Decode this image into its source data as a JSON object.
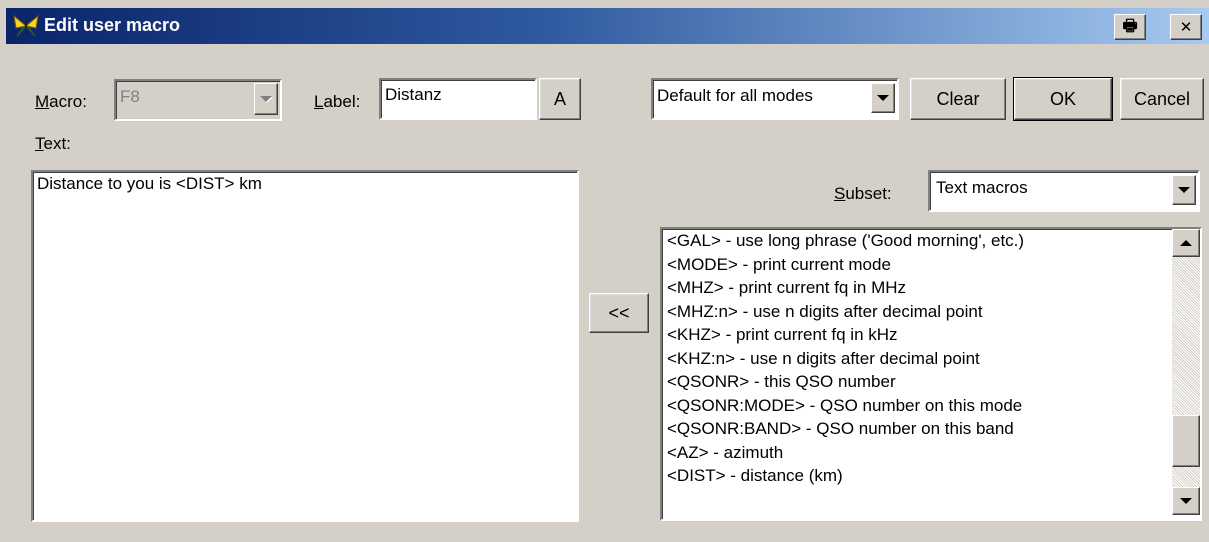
{
  "window": {
    "title": "Edit user macro",
    "icon": "butterfly-icon",
    "title_buttons": {
      "print": "🖶",
      "close": "✕"
    }
  },
  "macro": {
    "label_prefix": "M",
    "label_rest": "acro:",
    "value": "F8"
  },
  "label_field": {
    "label_prefix": "L",
    "label_rest": "abel:",
    "value": "Distanz",
    "font_button": "A"
  },
  "text_field": {
    "label_prefix": "T",
    "label_rest": "ext:",
    "value": "Distance to you is <DIST> km"
  },
  "mode_select": {
    "value": "Default for all modes"
  },
  "buttons": {
    "clear": "Clear",
    "ok": "OK",
    "cancel": "Cancel",
    "insert": "<<"
  },
  "subset": {
    "label_prefix": "S",
    "label_rest": "ubset:",
    "value": "Text macros"
  },
  "macro_list": [
    "<GAL> - use long phrase ('Good morning', etc.)",
    "<MODE> - print current mode",
    "<MHZ> - print current fq in MHz",
    "<MHZ:n> - use n digits after decimal point",
    "<KHZ> - print current fq in kHz",
    "<KHZ:n> - use n digits after decimal point",
    "<QSONR> - this QSO number",
    "<QSONR:MODE> - QSO number on this mode",
    "<QSONR:BAND> - QSO number on this band",
    "<AZ> - azimuth",
    "<DIST> - distance (km)"
  ],
  "list_scroll": {
    "thumb_position_fraction": 0.88
  },
  "colors": {
    "titlebar_start": "#0a246a",
    "titlebar_end": "#a6caf0",
    "face": "#d4d0c8"
  }
}
